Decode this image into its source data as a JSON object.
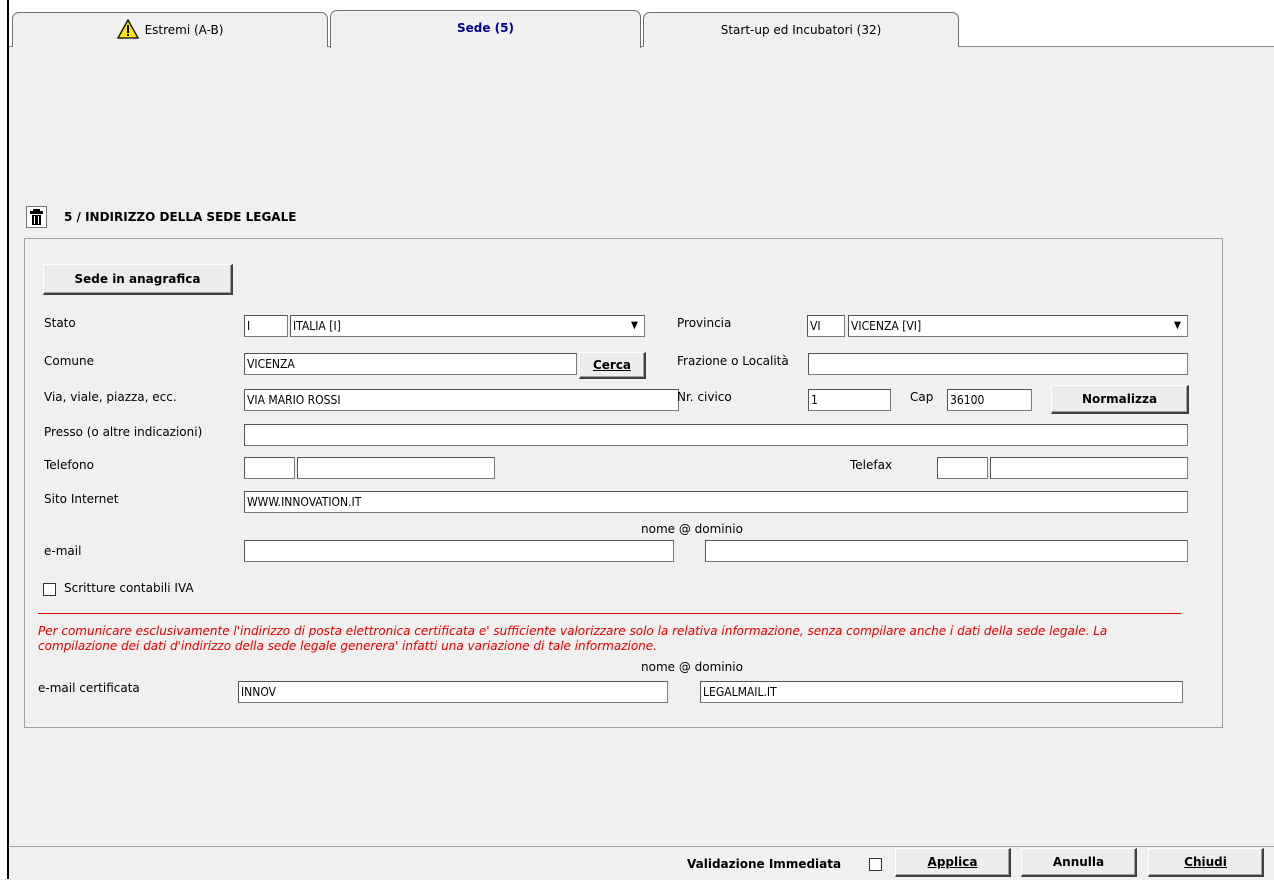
{
  "tabs": [
    {
      "label": "Estremi (A-B)"
    },
    {
      "label": "Sede (5)"
    },
    {
      "label": "Start-up ed Incubatori (32)"
    }
  ],
  "section": {
    "title": "5 / INDIRIZZO DELLA SEDE LEGALE",
    "sede_button": "Sede in anagrafica"
  },
  "form": {
    "stato_label": "Stato",
    "stato_code": "I",
    "stato_value": "ITALIA [I]",
    "provincia_label": "Provincia",
    "provincia_code": "VI",
    "provincia_value": "VICENZA [VI]",
    "comune_label": "Comune",
    "comune_value": "VICENZA",
    "cerca_button": "Cerca",
    "frazione_label": "Frazione o Località",
    "frazione_value": "",
    "via_label": "Via, viale, piazza, ecc.",
    "via_value": "VIA MARIO ROSSI",
    "civico_label": "Nr. civico",
    "civico_value": "1",
    "cap_label": "Cap",
    "cap_value": "36100",
    "normalizza_button": "Normalizza",
    "presso_label": "Presso (o altre indicazioni)",
    "presso_value": "",
    "telefono_label": "Telefono",
    "telefax_label": "Telefax",
    "sito_label": "Sito Internet",
    "sito_value": "WWW.INNOVATION.IT",
    "email_hint": "nome @  dominio",
    "email_label": "e-mail",
    "email_name": "",
    "email_domain": "",
    "scritture_label": "Scritture contabili IVA",
    "note": "Per comunicare esclusivamente l'indirizzo di posta elettronica certificata e' sufficiente valorizzare solo la relativa informazione, senza compilare anche i dati della sede legale. La compilazione dei dati d'indirizzo della sede legale generera' infatti una variazione di tale informazione.",
    "pec_hint": "nome @  dominio",
    "pec_label": "e-mail certificata",
    "pec_name": "INNOV",
    "pec_domain": "LEGALMAIL.IT"
  },
  "footer": {
    "validazione_label": "Validazione Immediata",
    "applica": "Applica",
    "annulla": "Annulla",
    "chiudi": "Chiudi"
  },
  "colors": {
    "note_red": "#e00000",
    "active_tab_text": "#00008b"
  }
}
